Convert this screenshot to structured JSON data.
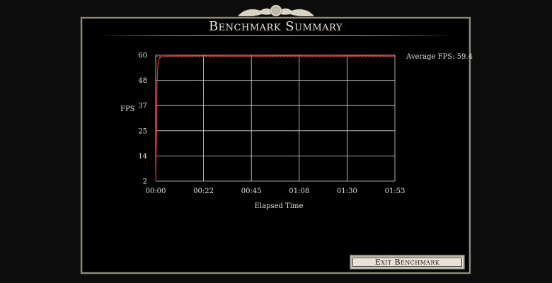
{
  "window": {
    "title": "Benchmark Summary"
  },
  "stats": {
    "average_fps_label": "Average FPS: 59.4"
  },
  "buttons": {
    "exit_label": "Exit Benchmark"
  },
  "colors": {
    "panel_border": "#8f8a7c",
    "text": "#e2ddd0",
    "grid": "#d8d8d8",
    "series_line": "#e02a2a",
    "average_line": "#9a7b52"
  },
  "chart_data": {
    "type": "line",
    "title": "",
    "xlabel": "Elapsed Time",
    "ylabel": "FPS",
    "x_ticks": [
      "00:00",
      "00:22",
      "00:45",
      "01:08",
      "01:30",
      "01:53"
    ],
    "y_ticks": [
      "2",
      "14",
      "25",
      "37",
      "48",
      "60"
    ],
    "ylim": [
      2,
      60
    ],
    "xlim_seconds": [
      0,
      113
    ],
    "grid": true,
    "series": [
      {
        "x_seconds": [
          0,
          0.3,
          0.6,
          1.0,
          1.5,
          2,
          5,
          20,
          40,
          60,
          80,
          100,
          113
        ],
        "values": [
          2,
          20,
          45,
          55,
          58,
          59,
          59.5,
          59.6,
          59.5,
          59.6,
          59.5,
          59.6,
          59.5
        ]
      }
    ],
    "average": 59.4
  }
}
